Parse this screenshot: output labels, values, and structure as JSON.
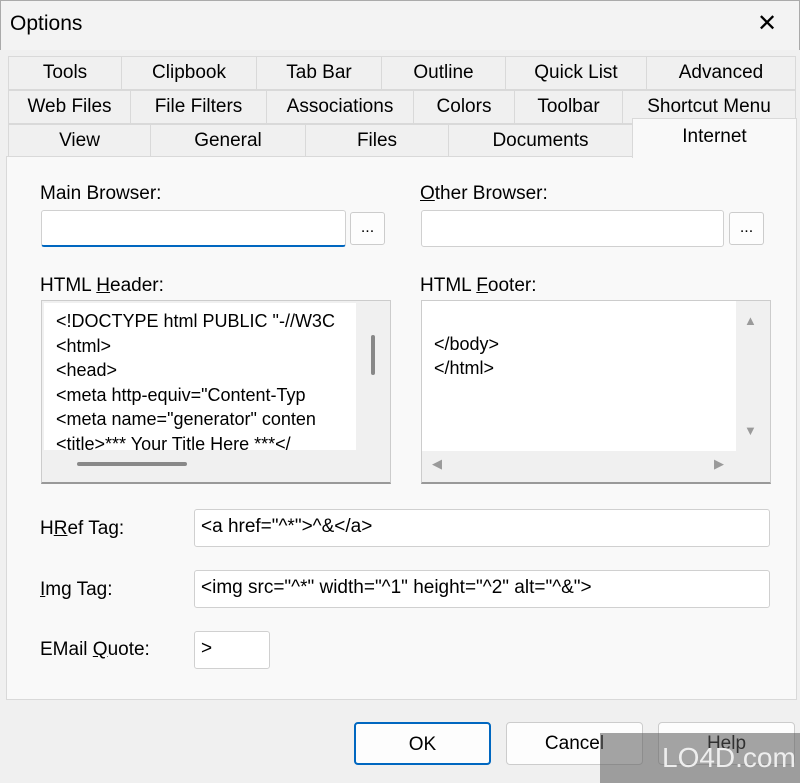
{
  "window": {
    "title": "Options",
    "close_icon": "close-icon"
  },
  "tabs": {
    "row1": [
      "Tools",
      "Clipbook",
      "Tab Bar",
      "Outline",
      "Quick List",
      "Advanced"
    ],
    "row2": [
      "Web Files",
      "File Filters",
      "Associations",
      "Colors",
      "Toolbar",
      "Shortcut Menu"
    ],
    "row3": [
      "View",
      "General",
      "Files",
      "Documents",
      "Internet"
    ],
    "active": "Internet"
  },
  "internet": {
    "main_browser": {
      "label": "Main Browser:",
      "value": "",
      "browse_label": "..."
    },
    "other_browser": {
      "label_accel": "O",
      "label_rest": "ther Browser:",
      "value": "",
      "browse_label": "..."
    },
    "html_header": {
      "label_pre": "HTML ",
      "label_accel": "H",
      "label_rest": "eader:",
      "text": "<!DOCTYPE html PUBLIC \"-//W3C\n<html>\n<head>\n<meta http-equiv=\"Content-Typ\n<meta name=\"generator\" conten\n<title>*** Your Title Here ***</"
    },
    "html_footer": {
      "label_pre": "HTML ",
      "label_accel": "F",
      "label_rest": "ooter:",
      "text": "\n</body>\n</html>"
    },
    "href_tag": {
      "label_pre": "H",
      "label_accel": "R",
      "label_rest": "ef Tag:",
      "value": "<a href=\"^*\">^&</a>"
    },
    "img_tag": {
      "label_accel": "I",
      "label_rest": "mg Tag:",
      "value": "<img src=\"^*\" width=\"^1\" height=\"^2\" alt=\"^&\">"
    },
    "email_quote": {
      "label_pre": "EMail ",
      "label_accel": "Q",
      "label_rest": "uote:",
      "value": ">"
    }
  },
  "buttons": {
    "ok": "OK",
    "cancel": "Cancel",
    "help": "Help"
  },
  "watermark": "LO4D.com"
}
